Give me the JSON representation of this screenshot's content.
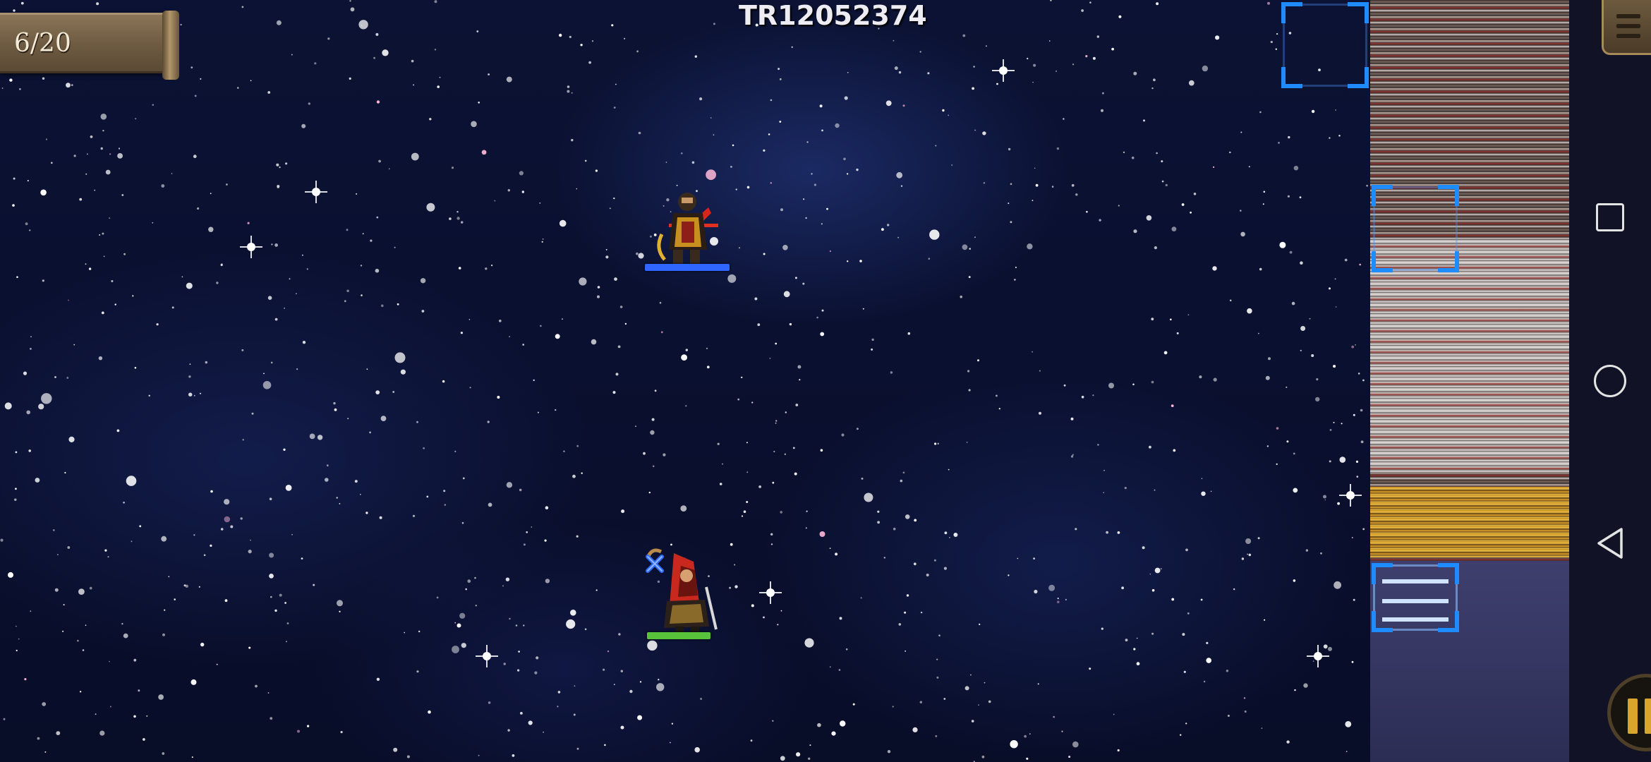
{
  "hud": {
    "wave_counter": "6/20",
    "room_code": "TR12052374"
  },
  "units": [
    {
      "name": "enemy-general",
      "hp_fraction": 1.0,
      "bar_color": "#2f66ff"
    },
    {
      "name": "player-hero",
      "hp_fraction": 1.0,
      "bar_color": "#58c23a",
      "marker": "x-marker-icon"
    }
  ],
  "colors": {
    "selection_frame": "#1e8bff",
    "enemy_hp": "#2f66ff",
    "player_hp": "#58c23a",
    "scroll_text": "#f3ead7"
  },
  "system_nav": {
    "buttons": [
      "recents-button",
      "home-button",
      "back-button"
    ]
  }
}
